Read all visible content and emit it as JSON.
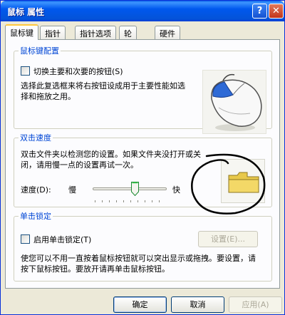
{
  "window": {
    "title": "鼠标 属性",
    "help_label": "?",
    "close_label": "✕"
  },
  "tabs": [
    "鼠标键",
    "指针",
    "指针选项",
    "轮",
    "硬件"
  ],
  "button_config": {
    "legend": "鼠标键配置",
    "switch_label": "切换主要和次要的按钮(S)",
    "switch_checked": false,
    "description": "选择此复选框来将右按钮设成用于主要性能如选择和拖放之用。"
  },
  "double_click": {
    "legend": "双击速度",
    "description": "双击文件夹以检测您的设置。如果文件夹没打开或关闭，请用慢一点的设置再试一次。",
    "speed_label": "速度(D):",
    "slow_label": "慢",
    "fast_label": "快",
    "speed_level_fraction": 0.58
  },
  "click_lock": {
    "legend": "单击锁定",
    "enable_label": "启用单击锁定(T)",
    "enable_checked": false,
    "settings_label": "设置(E)...",
    "description": "使您可以不用一直按着鼠标按钮就可以突出显示或拖拽。要设置，请按下鼠标按钮。要放开请再单击鼠标按钮。"
  },
  "footer": {
    "ok_label": "确定",
    "cancel_label": "取消",
    "apply_label": "应用(A)"
  },
  "colors": {
    "title_bar": "#0058EE",
    "group_legend": "#0046D5",
    "active_tab_highlight": "#FFC83C",
    "folder": "#E8C84A"
  }
}
